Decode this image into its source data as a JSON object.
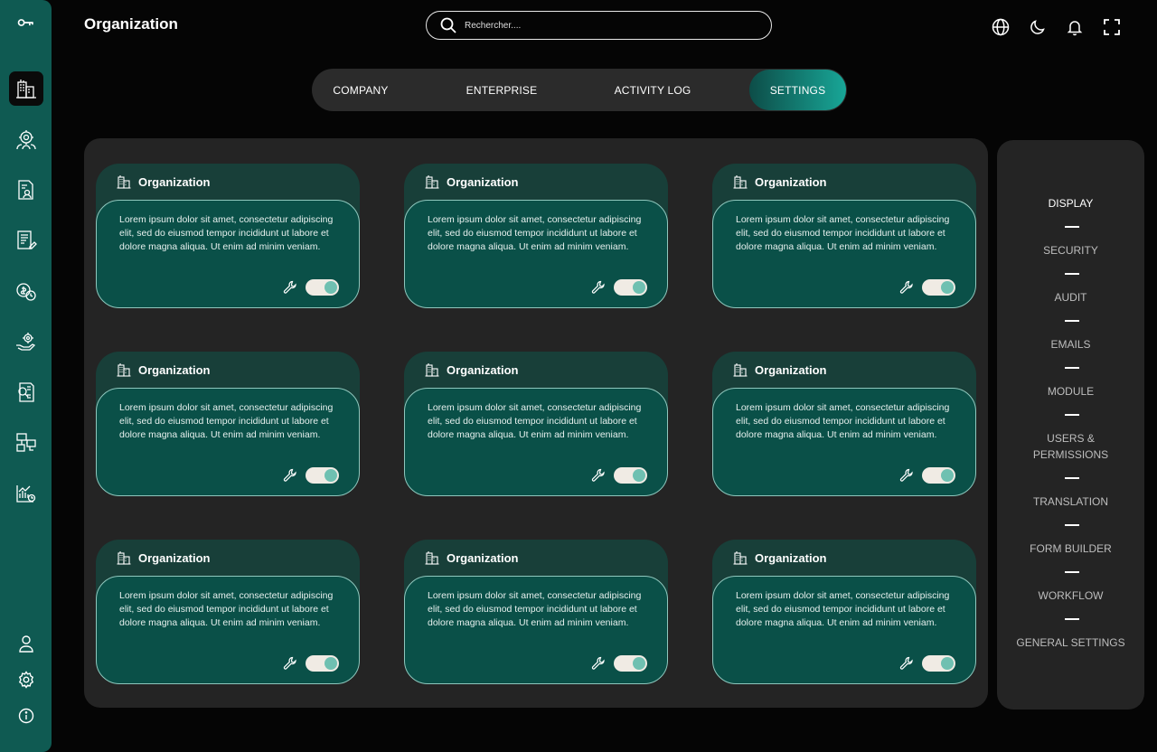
{
  "header": {
    "title": "Organization",
    "search_placeholder": "Rechercher....",
    "icons": [
      "globe-icon",
      "moon-icon",
      "bell-icon",
      "fullscreen-icon"
    ]
  },
  "sidebar": {
    "logo_icon": "key-icon",
    "items": [
      {
        "icon": "building-icon",
        "active": true
      },
      {
        "icon": "users-gear-icon",
        "active": false
      },
      {
        "icon": "document-user-icon",
        "active": false
      },
      {
        "icon": "document-edit-icon",
        "active": false
      },
      {
        "icon": "money-clock-icon",
        "active": false
      },
      {
        "icon": "hand-gear-icon",
        "active": false
      },
      {
        "icon": "document-search-icon",
        "active": false
      },
      {
        "icon": "network-screens-icon",
        "active": false
      },
      {
        "icon": "chart-report-icon",
        "active": false
      }
    ],
    "bottom": [
      "user-icon",
      "settings-icon",
      "info-icon"
    ]
  },
  "tabs": [
    {
      "label": "COMPANY",
      "active": false
    },
    {
      "label": "ENTERPRISE",
      "active": false
    },
    {
      "label": "ACTIVITY LOG",
      "active": false
    },
    {
      "label": "SETTINGS",
      "active": true
    }
  ],
  "cards": [
    {
      "title": "Organization",
      "text": "Lorem ipsum dolor sit amet, consectetur adipiscing elit, sed do eiusmod tempor incididunt ut labore et dolore magna aliqua. Ut enim ad minim veniam.",
      "enabled": true
    },
    {
      "title": "Organization",
      "text": "Lorem ipsum dolor sit amet, consectetur adipiscing elit, sed do eiusmod tempor incididunt ut labore et dolore magna aliqua. Ut enim ad minim veniam.",
      "enabled": true
    },
    {
      "title": "Organization",
      "text": "Lorem ipsum dolor sit amet, consectetur adipiscing elit, sed do eiusmod tempor incididunt ut labore et dolore magna aliqua. Ut enim ad minim veniam.",
      "enabled": true
    },
    {
      "title": "Organization",
      "text": "Lorem ipsum dolor sit amet, consectetur adipiscing elit, sed do eiusmod tempor incididunt ut labore et dolore magna aliqua. Ut enim ad minim veniam.",
      "enabled": true
    },
    {
      "title": "Organization",
      "text": "Lorem ipsum dolor sit amet, consectetur adipiscing elit, sed do eiusmod tempor incididunt ut labore et dolore magna aliqua. Ut enim ad minim veniam.",
      "enabled": true
    },
    {
      "title": "Organization",
      "text": "Lorem ipsum dolor sit amet, consectetur adipiscing elit, sed do eiusmod tempor incididunt ut labore et dolore magna aliqua. Ut enim ad minim veniam.",
      "enabled": true
    },
    {
      "title": "Organization",
      "text": "Lorem ipsum dolor sit amet, consectetur adipiscing elit, sed do eiusmod tempor incididunt ut labore et dolore magna aliqua. Ut enim ad minim veniam.",
      "enabled": true
    },
    {
      "title": "Organization",
      "text": "Lorem ipsum dolor sit amet, consectetur adipiscing elit, sed do eiusmod tempor incididunt ut labore et dolore magna aliqua. Ut enim ad minim veniam.",
      "enabled": true
    },
    {
      "title": "Organization",
      "text": "Lorem ipsum dolor sit amet, consectetur adipiscing elit, sed do eiusmod tempor incididunt ut labore et dolore magna aliqua. Ut enim ad minim veniam.",
      "enabled": true
    }
  ],
  "settings_menu": [
    {
      "label": "DISPLAY",
      "active": true
    },
    {
      "label": "SECURITY",
      "active": false
    },
    {
      "label": "AUDIT",
      "active": false
    },
    {
      "label": "EMAILS",
      "active": false
    },
    {
      "label": "MODULE",
      "active": false
    },
    {
      "label": "USERS & PERMISSIONS",
      "active": false
    },
    {
      "label": "TRANSLATION",
      "active": false
    },
    {
      "label": "FORM BUILDER",
      "active": false
    },
    {
      "label": "WORKFLOW",
      "active": false
    },
    {
      "label": "GENERAL SETTINGS",
      "active": false
    }
  ],
  "colors": {
    "background": "#050505",
    "sidebar": "#0f5a52",
    "panel": "#242424",
    "card_outer": "#183f39",
    "card_inner": "#0a5048",
    "accent": "#18a697",
    "toggle_knob": "#6fc0b1"
  }
}
